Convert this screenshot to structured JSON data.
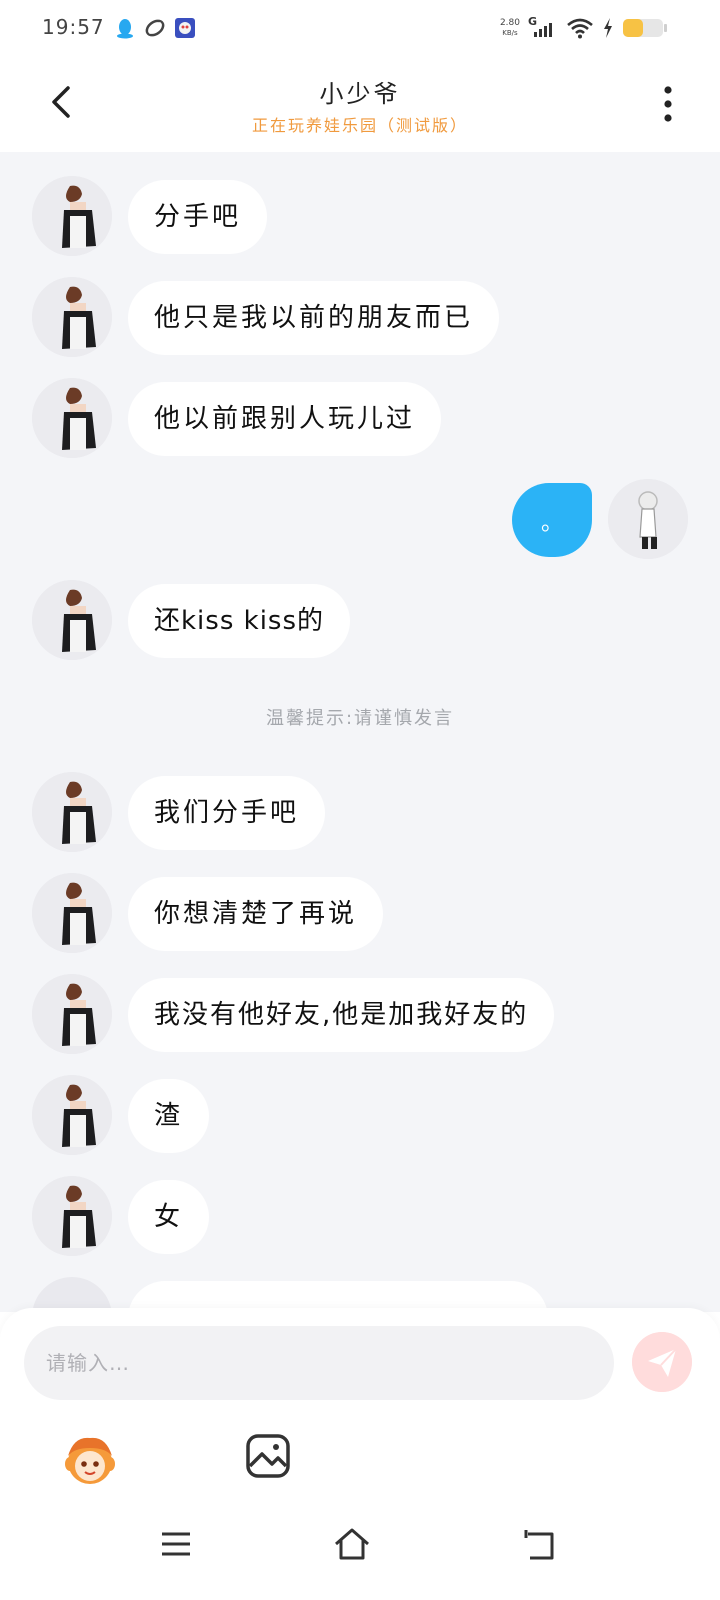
{
  "status_bar": {
    "time": "19:57",
    "speed_value": "2.80",
    "speed_unit": "KB/s",
    "network": "G",
    "icons": [
      "qq-icon",
      "link-icon",
      "game-icon",
      "signal-icon",
      "wifi-icon",
      "charging-icon",
      "battery-icon"
    ]
  },
  "header": {
    "title": "小少爷",
    "subtitle": "正在玩养娃乐园（测试版）"
  },
  "messages": [
    {
      "side": "left",
      "text": "分手吧"
    },
    {
      "side": "left",
      "text": "他只是我以前的朋友而已"
    },
    {
      "side": "left",
      "text": "他以前跟别人玩儿过"
    },
    {
      "side": "right",
      "text": "。"
    },
    {
      "side": "left",
      "text": "还kiss kiss的"
    }
  ],
  "tip": "温馨提示:请谨慎发言",
  "messages_after_tip": [
    {
      "side": "left",
      "text": "我们分手吧"
    },
    {
      "side": "left",
      "text": "你想清楚了再说"
    },
    {
      "side": "left",
      "text": "我没有他好友,他是加我好友的"
    },
    {
      "side": "left",
      "text": "渣"
    },
    {
      "side": "left",
      "text": "女"
    }
  ],
  "input": {
    "placeholder": "请输入…",
    "value": ""
  },
  "colors": {
    "accent_orange": "#f09a3e",
    "outgoing_bubble": "#2bb3f6",
    "chat_background": "#f4f5f8",
    "send_button": "#ffdcdc"
  }
}
